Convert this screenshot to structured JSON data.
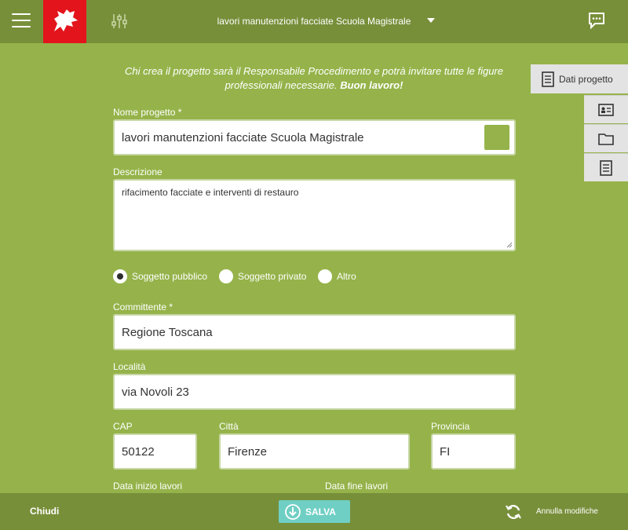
{
  "header": {
    "project_title": "lavori manutenzioni facciate Scuola Magistrale"
  },
  "intro": {
    "text": "Chi crea il progetto sarà il Responsabile Procedimento e potrà invitare tutte le figure professionali necessarie.",
    "bold": "Buon lavoro!"
  },
  "form": {
    "project_name_label": "Nome progetto *",
    "project_name_value": "lavori manutenzioni facciate Scuola Magistrale",
    "description_label": "Descrizione",
    "description_value": "rifacimento facciate e interventi di restauro",
    "subject_options": [
      "Soggetto pubblico",
      "Soggetto privato",
      "Altro"
    ],
    "subject_selected": "Soggetto pubblico",
    "client_label": "Committente *",
    "client_value": "Regione Toscana",
    "location_label": "Località",
    "location_value": "via Novoli 23",
    "cap_label": "CAP",
    "cap_value": "50122",
    "city_label": "Città",
    "city_value": "Firenze",
    "province_label": "Provincia",
    "province_value": "FI",
    "start_date_label": "Data inizio lavori",
    "end_date_label": "Data fine lavori",
    "project_color": "#95b34a"
  },
  "side_tabs": {
    "main_label": "Dati progetto",
    "icons": [
      "id-card-icon",
      "folder-icon",
      "document-icon"
    ]
  },
  "footer": {
    "close_label": "Chiudi",
    "save_label": "SALVA",
    "undo_label": "Annulla modifiche"
  },
  "colors": {
    "background": "#95b34a",
    "bars": "#788f3a",
    "save_button": "#6fcfc4",
    "logo": "#e3141c"
  }
}
